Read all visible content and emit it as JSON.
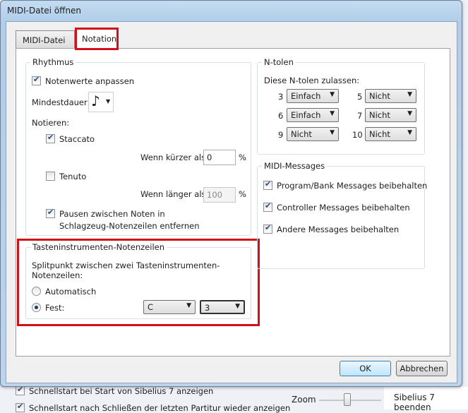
{
  "window": {
    "title": "MIDI-Datei öffnen"
  },
  "tabs": [
    {
      "label": "MIDI-Datei",
      "active": false
    },
    {
      "label": "Notation",
      "active": true
    }
  ],
  "rhythmus": {
    "title": "Rhythmus",
    "notenwerte": {
      "label": "Notenwerte anpassen",
      "checked": true
    },
    "mindestdauer_label": "Mindestdauer:",
    "mindestdauer_value": "eighth-note-icon",
    "mindestdauer_glyph": "♪",
    "notieren_label": "Notieren:",
    "staccato": {
      "label": "Staccato",
      "checked": true
    },
    "kuerzer": {
      "label": "Wenn kürzer als:",
      "value": "0",
      "unit": "%"
    },
    "tenuto": {
      "label": "Tenuto",
      "checked": false
    },
    "laenger": {
      "label": "Wenn länger als:",
      "value": "100",
      "unit": "%"
    },
    "pausen": {
      "label1": "Pausen zwischen Noten in",
      "label2": "Schlagzeug-Notenzeilen entfernen",
      "checked": true
    }
  },
  "tasten": {
    "title": "Tasteninstrumenten-Notenzeilen",
    "desc1": "Splitpunkt zwischen zwei Tasteninstrumenten-",
    "desc2": "Notenzeilen:",
    "auto": {
      "label": "Automatisch",
      "selected": false
    },
    "fest": {
      "label": "Fest:",
      "selected": true
    },
    "note": "C",
    "octave": "3"
  },
  "ntolen": {
    "title": "N-tolen",
    "desc": "Diese N-tolen zulassen:",
    "rows": [
      {
        "n": "3",
        "value": "Einfach"
      },
      {
        "n": "5",
        "value": "Nicht"
      },
      {
        "n": "6",
        "value": "Einfach"
      },
      {
        "n": "7",
        "value": "Nicht"
      },
      {
        "n": "9",
        "value": "Nicht"
      },
      {
        "n": "10",
        "value": "Nicht"
      }
    ]
  },
  "midi": {
    "title": "MIDI-Messages",
    "items": [
      {
        "label": "Program/Bank Messages beibehalten",
        "checked": true
      },
      {
        "label": "Controller Messages beibehalten",
        "checked": true
      },
      {
        "label": "Andere Messages beibehalten",
        "checked": true
      }
    ]
  },
  "buttons": {
    "ok": "OK",
    "cancel": "Abbrechen"
  },
  "background": {
    "check1": "Schnellstart bei Start von Sibelius 7 anzeigen",
    "check2": "Schnellstart nach Schließen der letzten Partitur wieder anzeigen",
    "zoom": "Zoom",
    "quit": "Sibelius 7 beenden"
  },
  "accent": "#d0101a"
}
